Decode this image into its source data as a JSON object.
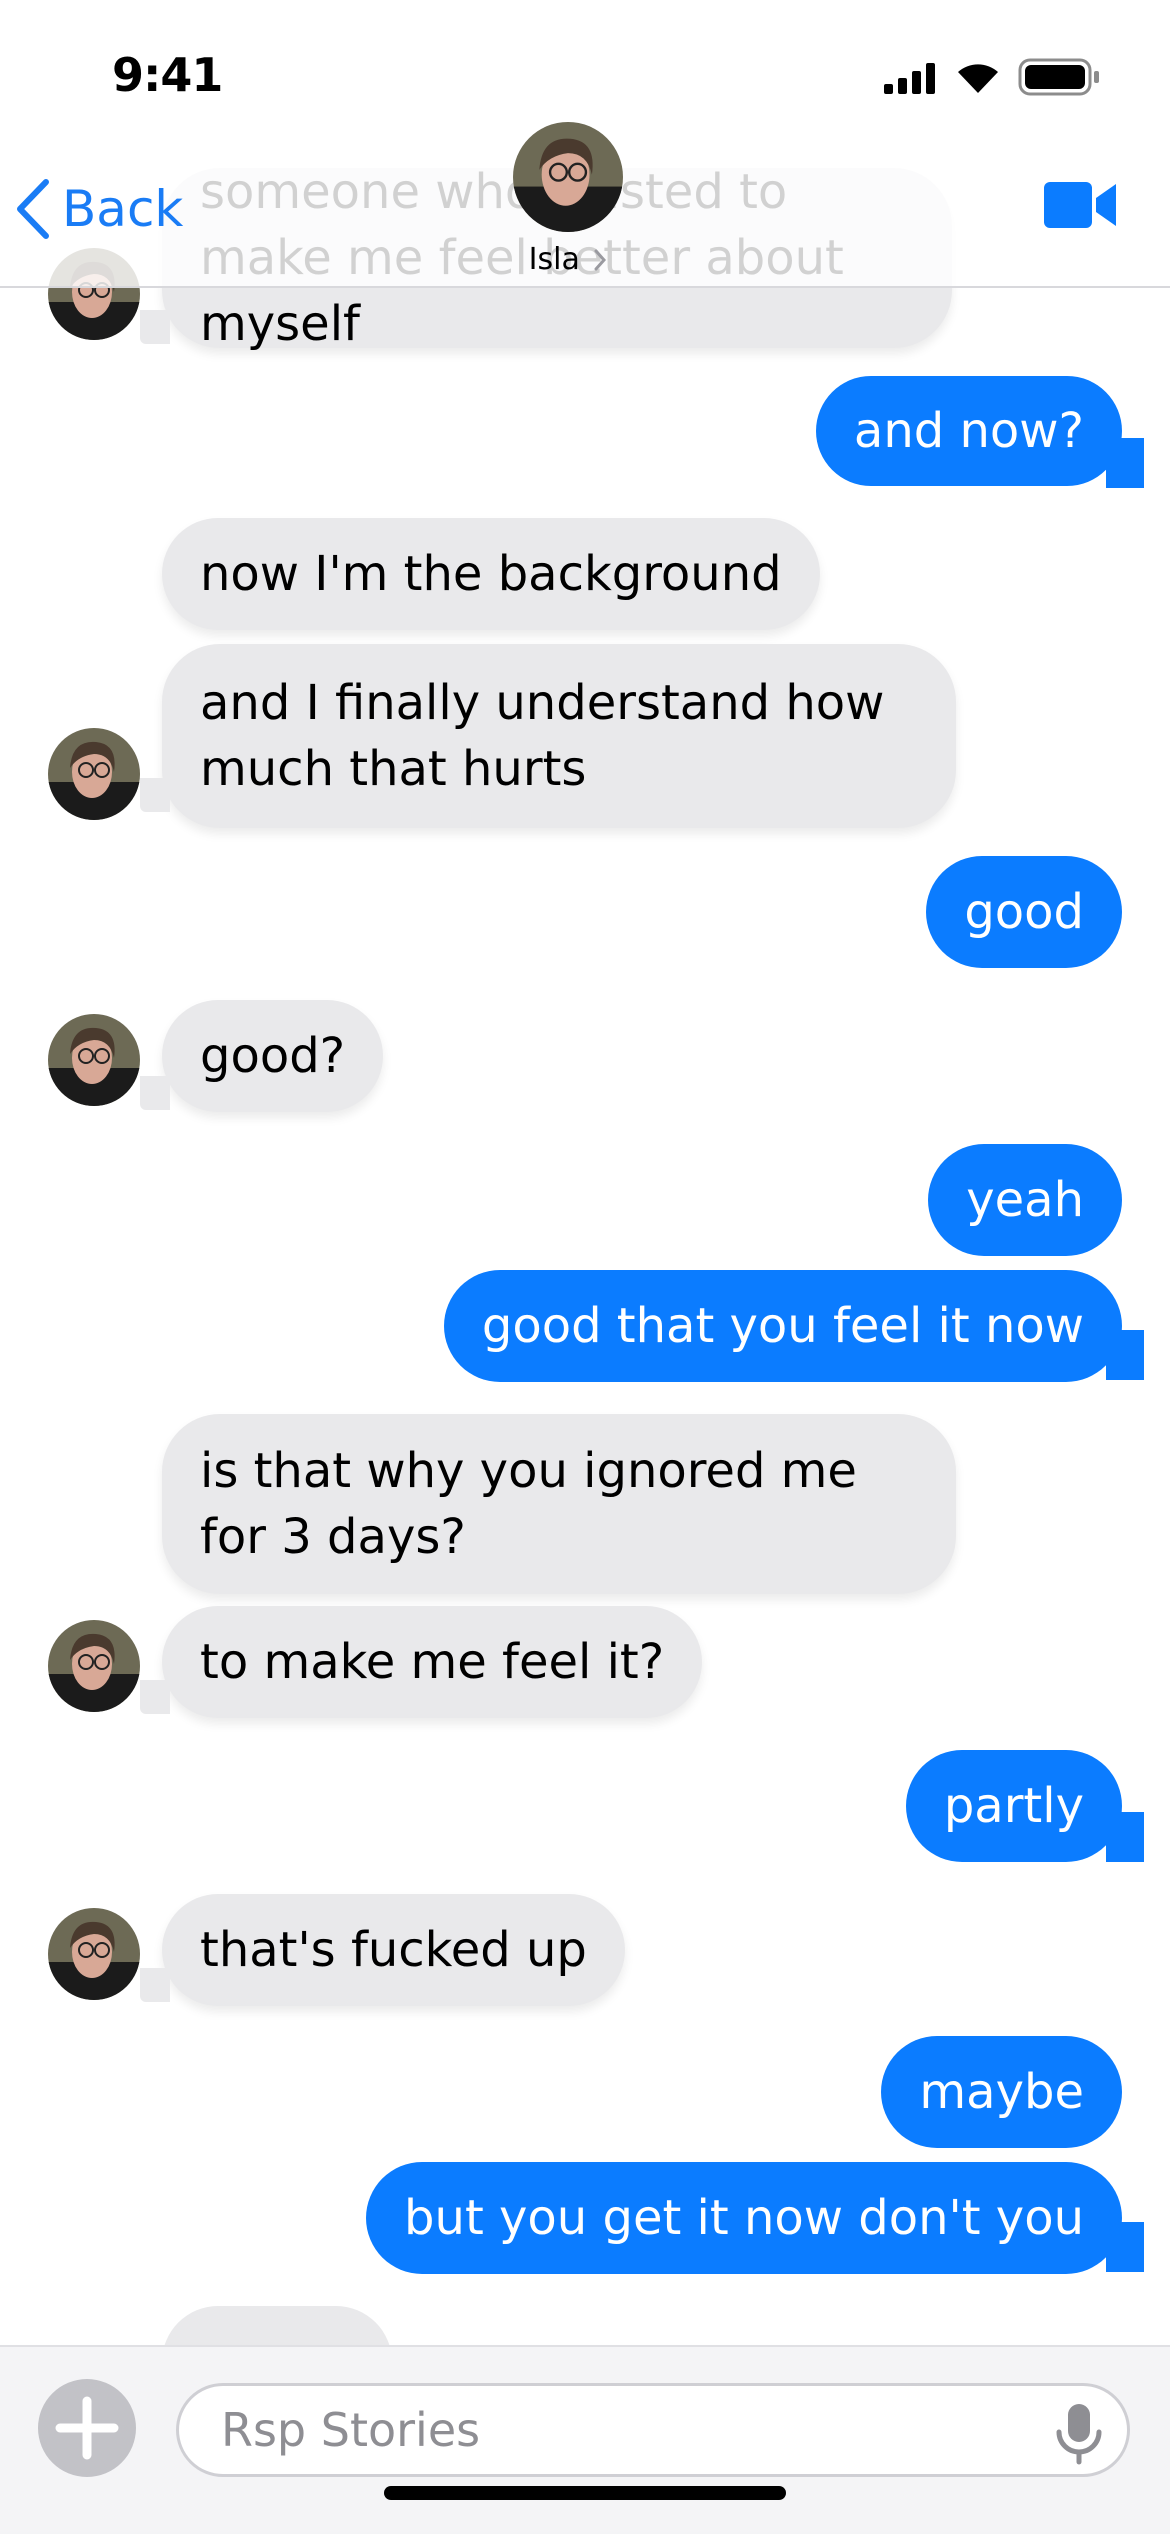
{
  "status_bar": {
    "time": "9:41",
    "icons": [
      "signal-icon",
      "wifi-icon",
      "battery-icon"
    ]
  },
  "header": {
    "back_label": "Back",
    "contact_name": "Isla",
    "icons": [
      "chevron-left-icon",
      "chevron-right-icon",
      "video-camera-icon"
    ]
  },
  "colors": {
    "accent": "#0b7cff",
    "incoming_bubble": "#e9e9eb",
    "background": "#ffffff"
  },
  "messages": [
    {
      "from": "them",
      "text": "someone who existed to make me feel better about myself"
    },
    {
      "from": "me",
      "text": "and now?"
    },
    {
      "from": "them",
      "text": "now I'm the background"
    },
    {
      "from": "them",
      "text": "and I finally understand how much that hurts"
    },
    {
      "from": "me",
      "text": "good"
    },
    {
      "from": "them",
      "text": "good?"
    },
    {
      "from": "me",
      "text": "yeah"
    },
    {
      "from": "me",
      "text": "good that you feel it now"
    },
    {
      "from": "them",
      "text": "is that why you ignored me for 3 days?"
    },
    {
      "from": "them",
      "text": "to make me feel it?"
    },
    {
      "from": "me",
      "text": "partly"
    },
    {
      "from": "them",
      "text": "that's fucked up"
    },
    {
      "from": "me",
      "text": "maybe"
    },
    {
      "from": "me",
      "text": "but you get it now don't you"
    }
  ],
  "composer": {
    "placeholder": "Rsp Stories",
    "icons": [
      "plus-icon",
      "microphone-icon"
    ]
  }
}
